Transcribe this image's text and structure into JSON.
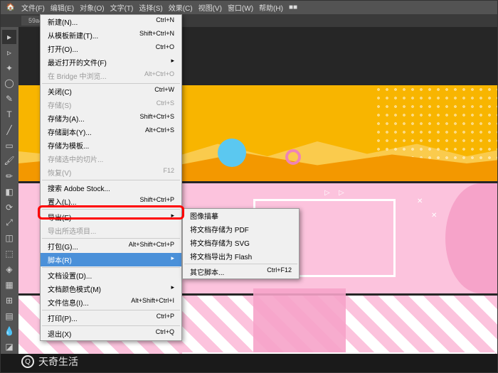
{
  "menubar": {
    "items": [
      "文件(F)",
      "编辑(E)",
      "对象(O)",
      "文字(T)",
      "选择(S)",
      "效果(C)",
      "视图(V)",
      "窗口(W)",
      "帮助(H)",
      "■■"
    ]
  },
  "tab": {
    "label": "59a4..."
  },
  "file_menu": {
    "items": [
      {
        "label": "新建(N)...",
        "shortcut": "Ctrl+N"
      },
      {
        "label": "从模板新建(T)...",
        "shortcut": "Shift+Ctrl+N"
      },
      {
        "label": "打开(O)...",
        "shortcut": "Ctrl+O"
      },
      {
        "label": "最近打开的文件(F)",
        "shortcut": "▸"
      },
      {
        "label": "在 Bridge 中浏览...",
        "shortcut": "Alt+Ctrl+O",
        "disabled": true
      },
      {
        "sep": true
      },
      {
        "label": "关闭(C)",
        "shortcut": "Ctrl+W"
      },
      {
        "label": "存储(S)",
        "shortcut": "Ctrl+S",
        "disabled": true
      },
      {
        "label": "存储为(A)...",
        "shortcut": "Shift+Ctrl+S"
      },
      {
        "label": "存储副本(Y)...",
        "shortcut": "Alt+Ctrl+S"
      },
      {
        "label": "存储为模板...",
        "shortcut": ""
      },
      {
        "label": "存储选中的切片...",
        "shortcut": "",
        "disabled": true
      },
      {
        "label": "恢复(V)",
        "shortcut": "F12",
        "disabled": true
      },
      {
        "sep": true
      },
      {
        "label": "搜索 Adobe Stock...",
        "shortcut": ""
      },
      {
        "label": "置入(L)...",
        "shortcut": "Shift+Ctrl+P"
      },
      {
        "sep": true
      },
      {
        "label": "导出(E)",
        "shortcut": "▸"
      },
      {
        "label": "导出所选项目...",
        "shortcut": "",
        "disabled": true
      },
      {
        "sep": true
      },
      {
        "label": "打包(G)...",
        "shortcut": "Alt+Shift+Ctrl+P"
      },
      {
        "label": "脚本(R)",
        "shortcut": "▸",
        "highlight": true
      },
      {
        "sep": true
      },
      {
        "label": "文档设置(D)...",
        "shortcut": ""
      },
      {
        "label": "文档颜色模式(M)",
        "shortcut": "▸"
      },
      {
        "label": "文件信息(I)...",
        "shortcut": "Alt+Shift+Ctrl+I"
      },
      {
        "sep": true
      },
      {
        "label": "打印(P)...",
        "shortcut": "Ctrl+P"
      },
      {
        "sep": true
      },
      {
        "label": "退出(X)",
        "shortcut": "Ctrl+Q"
      }
    ]
  },
  "submenu": {
    "items": [
      {
        "label": "图像描摹",
        "shortcut": ""
      },
      {
        "label": "将文档存储为 PDF",
        "shortcut": ""
      },
      {
        "label": "将文档存储为 SVG",
        "shortcut": ""
      },
      {
        "label": "将文档导出为 Flash",
        "shortcut": ""
      },
      {
        "sep": true
      },
      {
        "label": "其它脚本...",
        "shortcut": "Ctrl+F12"
      }
    ]
  },
  "watermark": {
    "text": "天奇生活"
  }
}
